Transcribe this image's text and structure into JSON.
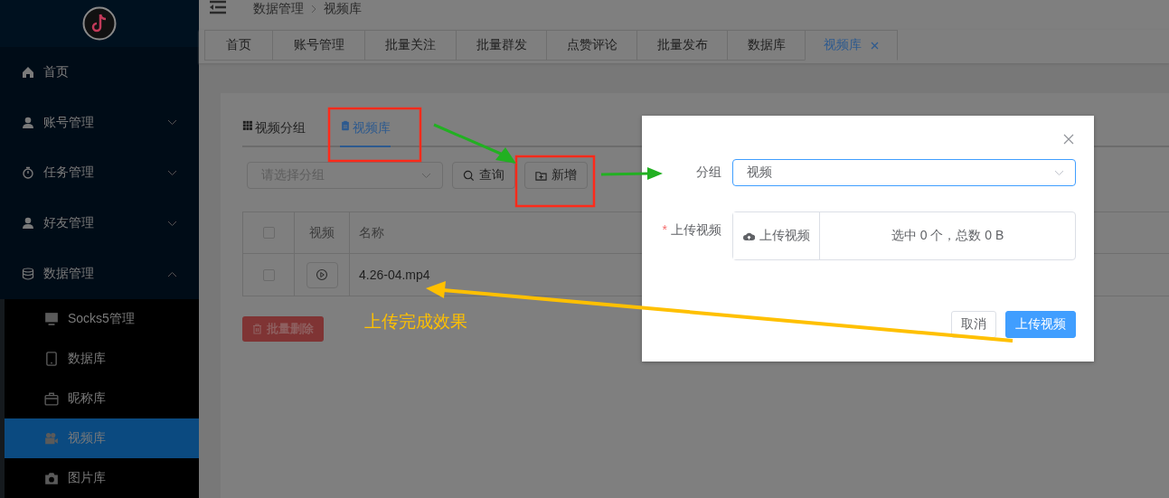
{
  "sidebar": {
    "items": [
      {
        "label": "首页",
        "kind": "link"
      },
      {
        "label": "账号管理",
        "kind": "group",
        "expanded": false
      },
      {
        "label": "任务管理",
        "kind": "group",
        "expanded": false
      },
      {
        "label": "好友管理",
        "kind": "group",
        "expanded": false
      },
      {
        "label": "数据管理",
        "kind": "group",
        "expanded": true,
        "children": [
          {
            "label": "Socks5管理",
            "selected": false
          },
          {
            "label": "数据库",
            "selected": false
          },
          {
            "label": "昵称库",
            "selected": false
          },
          {
            "label": "视频库",
            "selected": true
          },
          {
            "label": "图片库",
            "selected": false
          }
        ]
      }
    ]
  },
  "breadcrumb": [
    "数据管理",
    "视频库"
  ],
  "tabs": [
    {
      "label": "首页",
      "selected": false
    },
    {
      "label": "账号管理",
      "selected": false
    },
    {
      "label": "批量关注",
      "selected": false
    },
    {
      "label": "批量群发",
      "selected": false
    },
    {
      "label": "点赞评论",
      "selected": false
    },
    {
      "label": "批量发布",
      "selected": false
    },
    {
      "label": "数据库",
      "selected": false
    },
    {
      "label": "视频库",
      "selected": true
    }
  ],
  "page": {
    "sub_tabs": [
      {
        "label": "视频分组",
        "selected": false
      },
      {
        "label": "视频库",
        "selected": true
      }
    ],
    "group_select": {
      "placeholder": "请选择分组"
    },
    "buttons": [
      {
        "label": "查询",
        "kind": "search"
      },
      {
        "label": "新增",
        "kind": "add"
      }
    ],
    "table": {
      "header_checked": false,
      "columns": [
        "视频",
        "名称"
      ],
      "rows": [
        {
          "checked": false,
          "name": "4.26-04.mp4"
        }
      ]
    },
    "delete_button": "批量删除"
  },
  "dialog": {
    "group_label": "分组",
    "group_value": "视频",
    "required_mark": "*",
    "upload_label": "上传视频",
    "upload_button": "上传视频",
    "upload_status": "选中 0 个，总数 0 B",
    "buttons": [
      {
        "label": "取消",
        "kind": "default"
      },
      {
        "label": "上传视频",
        "kind": "primary"
      }
    ]
  },
  "annotation": {
    "caption": "上传完成效果"
  }
}
